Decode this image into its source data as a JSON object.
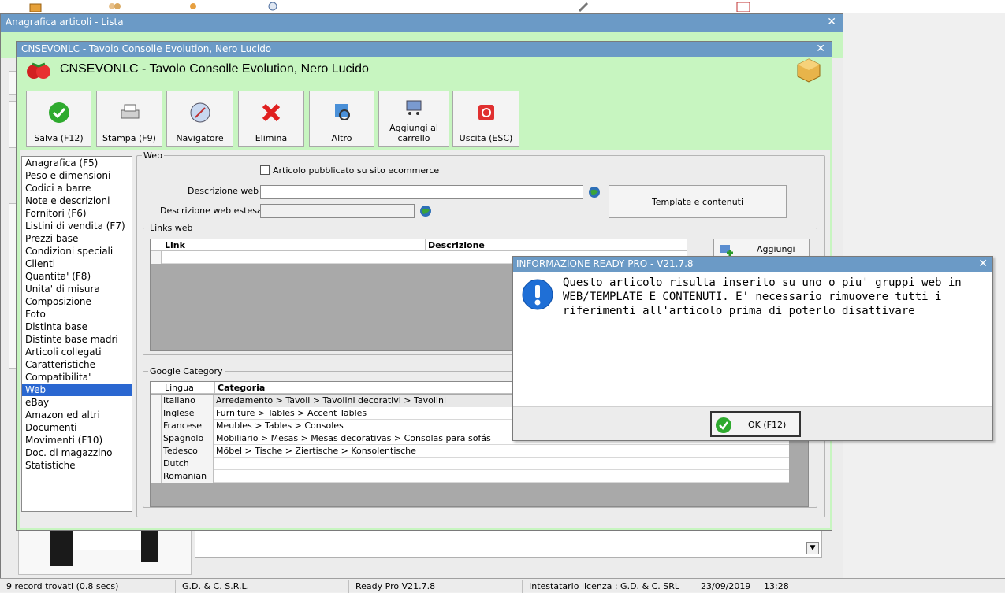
{
  "colors": {
    "titlebar": "#6b9ac6",
    "accent_green": "#c7f5c0",
    "selection": "#2a67d1"
  },
  "top_icons": [
    "box-icon",
    "users-icon",
    "person-icon",
    "clock-icon",
    "tools-icon",
    "calendar-icon"
  ],
  "bg_window": {
    "title": "Anagrafica articoli  - Lista"
  },
  "dialog": {
    "title": "CNSEVONLC - Tavolo Consolle Evolution, Nero Lucido",
    "heading": "CNSEVONLC - Tavolo Consolle Evolution, Nero Lucido"
  },
  "toolbar": {
    "save": "Salva (F12)",
    "print": "Stampa (F9)",
    "navigator": "Navigatore",
    "delete": "Elimina",
    "other": "Altro",
    "cart": "Aggiungi al carrello",
    "exit": "Uscita (ESC)"
  },
  "menu": [
    "Anagrafica (F5)",
    "Peso e dimensioni",
    "Codici a barre",
    "Note e descrizioni",
    "Fornitori (F6)",
    "Listini di vendita (F7)",
    "Prezzi base",
    "Condizioni speciali",
    "Clienti",
    "Quantita' (F8)",
    "Unita' di misura",
    "Composizione",
    "Foto",
    "Distinta base",
    "Distinte base madri",
    "Articoli collegati",
    "Caratteristiche",
    "Compatibilita'",
    "Web",
    "eBay",
    "Amazon ed altri",
    "Documenti",
    "Movimenti (F10)",
    "Doc. di magazzino",
    "Statistiche"
  ],
  "web": {
    "legend": "Web",
    "published_label": "Articolo pubblicato su sito ecommerce",
    "desc_label": "Descrizione web :",
    "desc_value": "",
    "desc_ext_label": "Descrizione web estesa :",
    "desc_ext_value": "",
    "template_button": "Template e contenuti"
  },
  "links": {
    "legend": "Links web",
    "col_link": "Link",
    "col_desc": "Descrizione",
    "add_button": "Aggiungi"
  },
  "google": {
    "legend": "Google Category",
    "col_lang": "Lingua",
    "col_cat": "Categoria",
    "rows": [
      {
        "lang": "Italiano",
        "cat": "Arredamento > Tavoli > Tavolini decorativi > Tavolini"
      },
      {
        "lang": "Inglese",
        "cat": "Furniture > Tables > Accent Tables"
      },
      {
        "lang": "Francese",
        "cat": "Meubles > Tables > Consoles"
      },
      {
        "lang": "Spagnolo",
        "cat": "Mobiliario > Mesas > Mesas decorativas > Consolas para sofás"
      },
      {
        "lang": "Tedesco",
        "cat": "Möbel > Tische > Ziertische > Konsolentische"
      },
      {
        "lang": "Dutch",
        "cat": ""
      },
      {
        "lang": "Romanian",
        "cat": ""
      }
    ]
  },
  "info": {
    "title": "INFORMAZIONE READY PRO - V21.7.8",
    "message_line1": "Questo articolo risulta inserito su uno o piu' gruppi web in",
    "message_line2": "WEB/TEMPLATE E CONTENUTI. E' necessario rimuovere tutti i",
    "message_line3": "riferimenti all'articolo prima di poterlo disattivare",
    "ok": "OK (F12)"
  },
  "status": {
    "records": "9 record trovati (0.8 secs)",
    "company": "G.D. & C. S.R.L.",
    "version": "Ready Pro V21.7.8",
    "license": "Intestatario licenza : G.D. & C. SRL",
    "date": "23/09/2019",
    "time": "13:28"
  }
}
